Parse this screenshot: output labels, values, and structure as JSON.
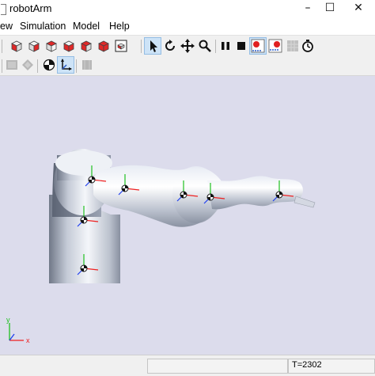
{
  "window": {
    "title": "robotArm"
  },
  "window_controls": {
    "minimize": "–",
    "maximize": "☐",
    "close": "✕"
  },
  "menu": {
    "items": [
      "ew",
      "Simulation",
      "Model",
      "Help"
    ]
  },
  "toolbar_icons": {
    "row1": [
      "view-front-icon",
      "view-back-icon",
      "view-left-icon",
      "view-right-icon",
      "view-top-icon",
      "view-bottom-icon",
      "fit-view-icon",
      "select-pointer-icon",
      "rotate-icon",
      "pan-icon",
      "zoom-icon",
      "pause-icon",
      "stop-icon",
      "record-icon",
      "record-settings-icon",
      "grid-icon",
      "timer-icon"
    ],
    "row2": [
      "box-icon",
      "perspective-icon",
      "center-of-mass-icon",
      "axes-frames-icon",
      "settings-icon"
    ]
  },
  "viewport": {
    "background": "#dcdcec",
    "axis_labels": {
      "x": "x",
      "y": "y"
    }
  },
  "status": {
    "time": "T=2302"
  },
  "colors": {
    "x_axis": "#ee2020",
    "y_axis": "#20c020",
    "z_axis": "#2040ee",
    "active_tool_bg": "#cde3f7",
    "record": "#e02020"
  }
}
